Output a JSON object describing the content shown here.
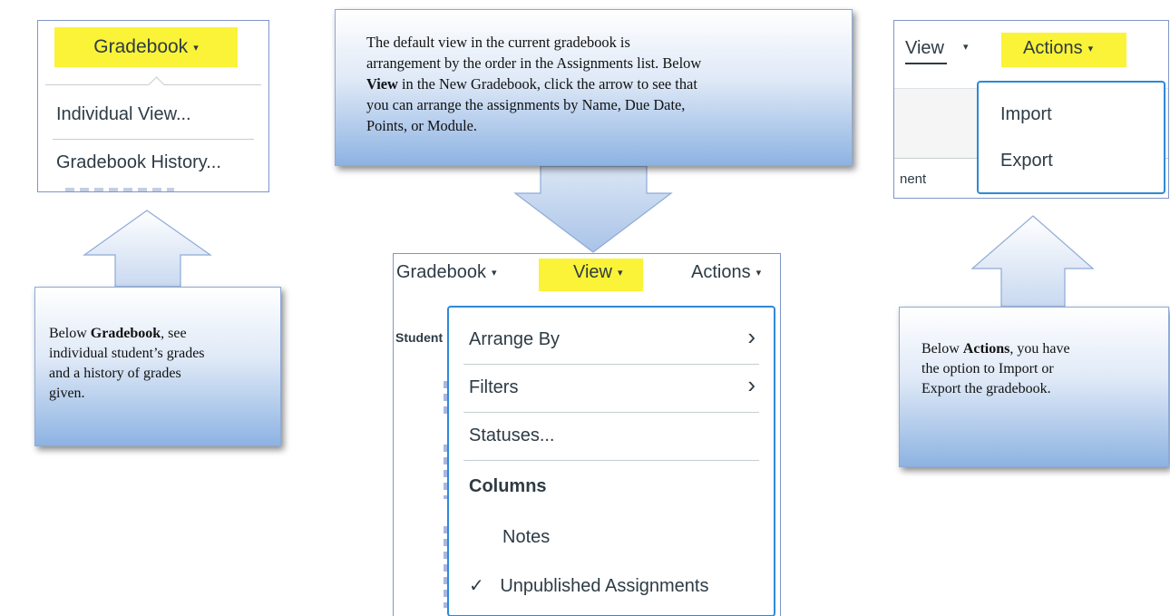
{
  "gradebook_panel": {
    "button_label": "Gradebook",
    "caret": "▾",
    "menu_items": [
      "Individual View...",
      "Gradebook History..."
    ]
  },
  "view_panel": {
    "header": {
      "gradebook": "Gradebook",
      "view": "View",
      "actions": "Actions"
    },
    "caret": "▾",
    "column_stub": "Student",
    "menu": {
      "arrange_by": "Arrange By",
      "filters": "Filters",
      "statuses": "Statuses...",
      "columns_heading": "Columns",
      "notes": "Notes",
      "unpublished": "Unpublished Assignments",
      "chevron": "›",
      "check": "✓"
    }
  },
  "actions_panel": {
    "view_label": "View",
    "actions_label": "Actions",
    "caret": "▾",
    "column_stub": "nent",
    "menu_items": [
      "Import",
      "Export"
    ]
  },
  "callouts": {
    "view": {
      "line1": "The default view in the current gradebook is",
      "line2": "arrangement by the order in the Assignments list. Below",
      "line3_bold": "View",
      "line3_rest": " in the New Gradebook, click the arrow to see that",
      "line4": "you can arrange the assignments by Name, Due Date,",
      "line5": "Points, or Module."
    },
    "gradebook": {
      "pre": "Below ",
      "bold": "Gradebook",
      "line1_rest": ", see",
      "line2": "individual student’s grades",
      "line3": "and a history of grades",
      "line4": "given."
    },
    "actions": {
      "pre": "Below ",
      "bold": "Actions",
      "line1_rest": ", you have",
      "line2": "the option to Import or",
      "line3": "Export the gradebook."
    }
  },
  "colors": {
    "highlight": "#fbf337",
    "menu_border": "#2d89d6",
    "text": "#2d3b45",
    "callout_top": "#ffffff",
    "callout_bottom": "#8db3e2"
  }
}
